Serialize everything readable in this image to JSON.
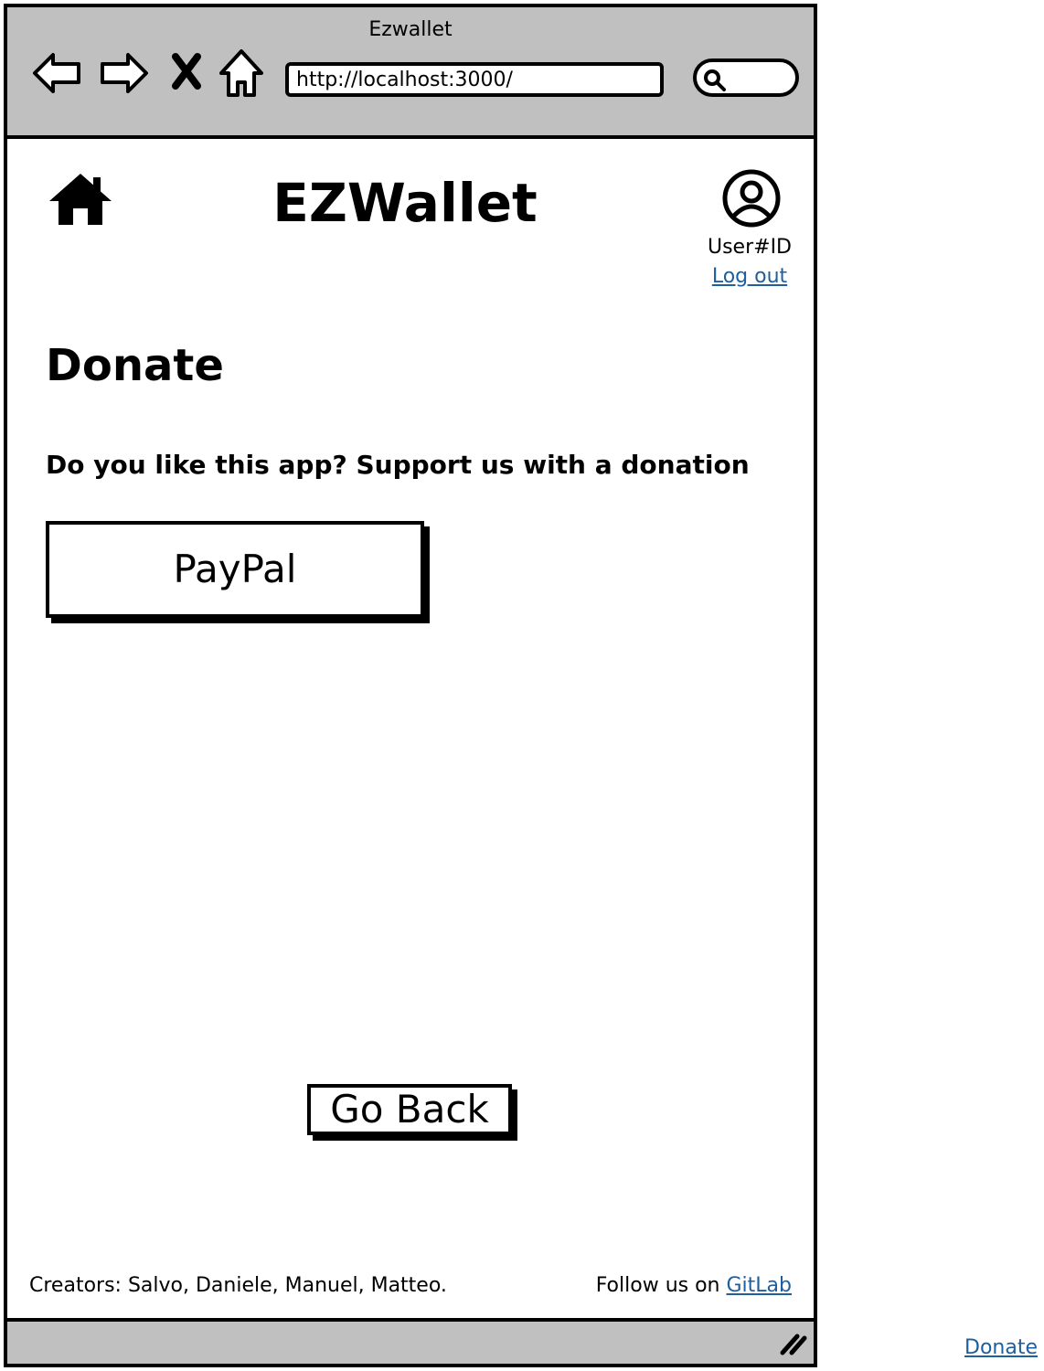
{
  "browser": {
    "window_title": "Ezwallet",
    "url": "http://localhost:3000/"
  },
  "header": {
    "app_title": "EZWallet",
    "user_id": "User#ID",
    "logout_label": "Log out"
  },
  "main": {
    "heading": "Donate",
    "tagline": "Do you like this app? Support us with a donation",
    "paypal_label": "PayPal",
    "go_back_label": "Go Back"
  },
  "footer": {
    "creators": "Creators: Salvo, Daniele, Manuel, Matteo.",
    "follow_prefix": "Follow us on",
    "gitlab_label": "GitLab"
  },
  "outside": {
    "donate_link": "Donate"
  },
  "colors": {
    "chrome_gray": "#c0c0c0",
    "link_blue": "#1f5fa0"
  }
}
